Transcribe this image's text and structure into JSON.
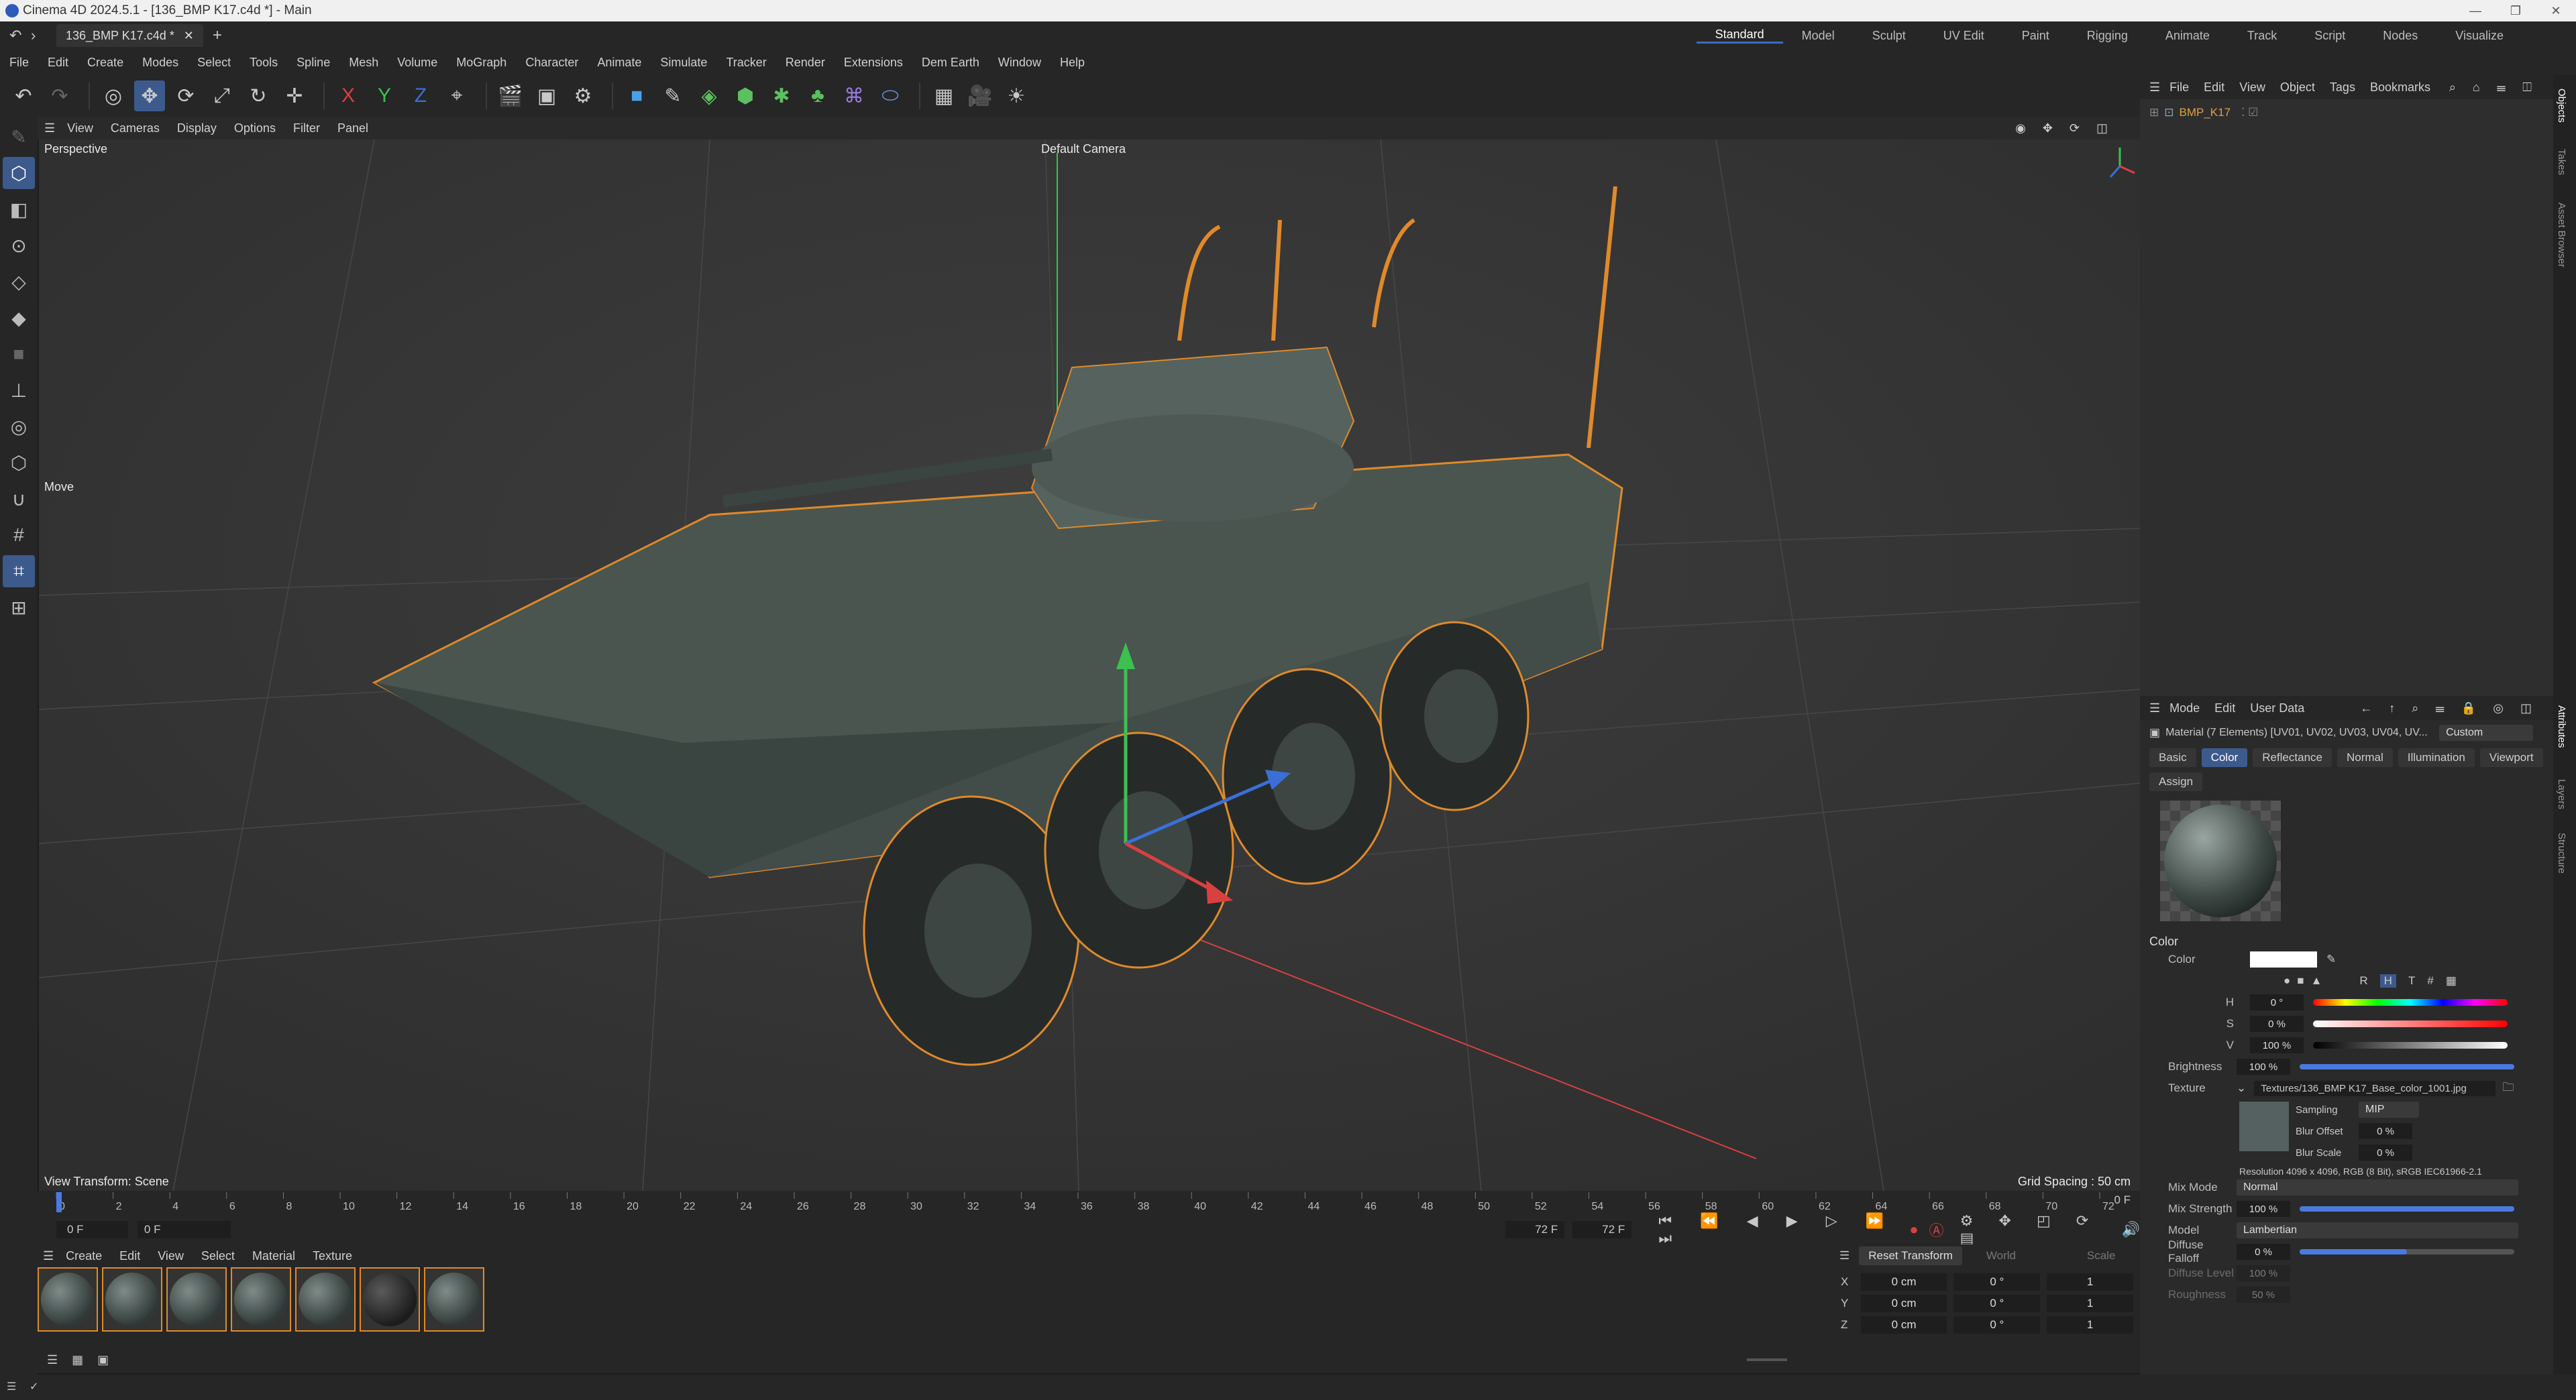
{
  "window": {
    "title": "Cinema 4D 2024.5.1 - [136_BMP K17.c4d *] - Main"
  },
  "tabs": {
    "doc": "136_BMP K17.c4d *",
    "plus": "+"
  },
  "layouts": [
    "Standard",
    "Model",
    "Sculpt",
    "UV Edit",
    "Paint",
    "Rigging",
    "Animate",
    "Track",
    "Script",
    "Nodes",
    "Visualize"
  ],
  "menu": [
    "File",
    "Edit",
    "Create",
    "Modes",
    "Select",
    "Tools",
    "Spline",
    "Mesh",
    "Volume",
    "MoGraph",
    "Character",
    "Animate",
    "Simulate",
    "Tracker",
    "Render",
    "Extensions",
    "Dem Earth",
    "Window",
    "Help"
  ],
  "viewport": {
    "menu": [
      "View",
      "Cameras",
      "Display",
      "Options",
      "Filter",
      "Panel"
    ],
    "perspective": "Perspective",
    "camera": "Default Camera",
    "tool_label": "Move",
    "view_transform": "View Transform: Scene",
    "grid_spacing": "Grid Spacing : 50 cm"
  },
  "timeline": {
    "ticks": [
      "0",
      "2",
      "4",
      "6",
      "8",
      "10",
      "12",
      "14",
      "16",
      "18",
      "20",
      "22",
      "24",
      "26",
      "28",
      "30",
      "32",
      "34",
      "36",
      "38",
      "40",
      "42",
      "44",
      "46",
      "48",
      "50",
      "52",
      "54",
      "56",
      "58",
      "60",
      "62",
      "64",
      "66",
      "68",
      "70",
      "72"
    ],
    "start": "0 F",
    "current": "0 F",
    "end": "72 F",
    "end2": "72 F",
    "frame_right": "0 F"
  },
  "material_manager": {
    "menu": [
      "Create",
      "Edit",
      "View",
      "Select",
      "Material",
      "Texture"
    ],
    "swatch_count_note": "7"
  },
  "coords": {
    "reset": "Reset Transform",
    "world": "World",
    "scale": "Scale",
    "rows": [
      {
        "axis": "X",
        "pos": "0 cm",
        "rot": "0 °",
        "scale": "1"
      },
      {
        "axis": "Y",
        "pos": "0 cm",
        "rot": "0 °",
        "scale": "1"
      },
      {
        "axis": "Z",
        "pos": "0 cm",
        "rot": "0 °",
        "scale": "1"
      }
    ]
  },
  "objects": {
    "menu": [
      "File",
      "Edit",
      "View",
      "Object",
      "Tags",
      "Bookmarks"
    ],
    "item": "BMP_K17"
  },
  "attributes": {
    "menu": [
      "Mode",
      "Edit",
      "User Data"
    ],
    "material_title": "Material (7 Elements) [UV01, UV02, UV03, UV04, UV...",
    "preset": "Custom",
    "tabs": [
      "Basic",
      "Color",
      "Reflectance",
      "Normal",
      "Illumination",
      "Viewport"
    ],
    "assign": "Assign",
    "section": "Color",
    "color_label": "Color",
    "h": {
      "label": "H",
      "value": "0 °"
    },
    "s": {
      "label": "S",
      "value": "0 %"
    },
    "v": {
      "label": "V",
      "value": "100 %"
    },
    "brightness": {
      "label": "Brightness",
      "value": "100 %",
      "level": 1.0
    },
    "texture": {
      "label": "Texture",
      "path": "Textures/136_BMP K17_Base_color_1001.jpg"
    },
    "sampling": {
      "label": "Sampling",
      "value": "MIP"
    },
    "blur_offset": {
      "label": "Blur Offset",
      "value": "0 %"
    },
    "blur_scale": {
      "label": "Blur Scale",
      "value": "0 %"
    },
    "resolution": "Resolution 4096 x 4096, RGB (8 Bit), sRGB IEC61966-2.1",
    "mix_mode": {
      "label": "Mix Mode",
      "value": "Normal"
    },
    "mix_strength": {
      "label": "Mix Strength",
      "value": "100 %",
      "level": 1.0
    },
    "model": {
      "label": "Model",
      "value": "Lambertian"
    },
    "diffuse_falloff": {
      "label": "Diffuse Falloff",
      "value": "0 %",
      "level": 0.5
    },
    "diffuse_level": {
      "label": "Diffuse Level",
      "value": "100 %"
    },
    "roughness": {
      "label": "Roughness",
      "value": "50 %"
    },
    "channel_btns": [
      "R",
      "H",
      "T",
      "#"
    ]
  },
  "side_tabs": [
    "Objects",
    "Takes",
    "Asset Browser",
    "Attributes",
    "Layers",
    "Structure"
  ],
  "colors": {
    "accent": "#3d5a8c",
    "selection": "#e08a2a",
    "axis_x": "#d94040",
    "axis_y": "#3cc050",
    "axis_z": "#3a6fd8"
  }
}
